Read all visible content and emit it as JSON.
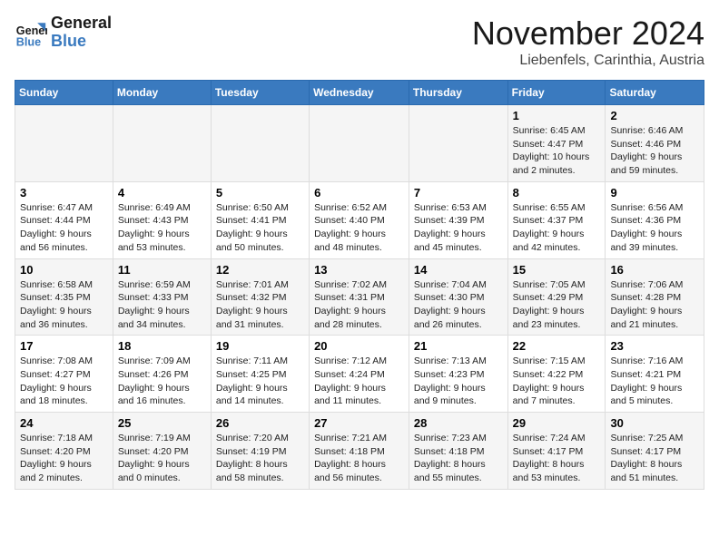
{
  "logo": {
    "line1": "General",
    "line2": "Blue"
  },
  "title": "November 2024",
  "location": "Liebenfels, Carinthia, Austria",
  "weekdays": [
    "Sunday",
    "Monday",
    "Tuesday",
    "Wednesday",
    "Thursday",
    "Friday",
    "Saturday"
  ],
  "weeks": [
    [
      {
        "day": "",
        "info": ""
      },
      {
        "day": "",
        "info": ""
      },
      {
        "day": "",
        "info": ""
      },
      {
        "day": "",
        "info": ""
      },
      {
        "day": "",
        "info": ""
      },
      {
        "day": "1",
        "info": "Sunrise: 6:45 AM\nSunset: 4:47 PM\nDaylight: 10 hours and 2 minutes."
      },
      {
        "day": "2",
        "info": "Sunrise: 6:46 AM\nSunset: 4:46 PM\nDaylight: 9 hours and 59 minutes."
      }
    ],
    [
      {
        "day": "3",
        "info": "Sunrise: 6:47 AM\nSunset: 4:44 PM\nDaylight: 9 hours and 56 minutes."
      },
      {
        "day": "4",
        "info": "Sunrise: 6:49 AM\nSunset: 4:43 PM\nDaylight: 9 hours and 53 minutes."
      },
      {
        "day": "5",
        "info": "Sunrise: 6:50 AM\nSunset: 4:41 PM\nDaylight: 9 hours and 50 minutes."
      },
      {
        "day": "6",
        "info": "Sunrise: 6:52 AM\nSunset: 4:40 PM\nDaylight: 9 hours and 48 minutes."
      },
      {
        "day": "7",
        "info": "Sunrise: 6:53 AM\nSunset: 4:39 PM\nDaylight: 9 hours and 45 minutes."
      },
      {
        "day": "8",
        "info": "Sunrise: 6:55 AM\nSunset: 4:37 PM\nDaylight: 9 hours and 42 minutes."
      },
      {
        "day": "9",
        "info": "Sunrise: 6:56 AM\nSunset: 4:36 PM\nDaylight: 9 hours and 39 minutes."
      }
    ],
    [
      {
        "day": "10",
        "info": "Sunrise: 6:58 AM\nSunset: 4:35 PM\nDaylight: 9 hours and 36 minutes."
      },
      {
        "day": "11",
        "info": "Sunrise: 6:59 AM\nSunset: 4:33 PM\nDaylight: 9 hours and 34 minutes."
      },
      {
        "day": "12",
        "info": "Sunrise: 7:01 AM\nSunset: 4:32 PM\nDaylight: 9 hours and 31 minutes."
      },
      {
        "day": "13",
        "info": "Sunrise: 7:02 AM\nSunset: 4:31 PM\nDaylight: 9 hours and 28 minutes."
      },
      {
        "day": "14",
        "info": "Sunrise: 7:04 AM\nSunset: 4:30 PM\nDaylight: 9 hours and 26 minutes."
      },
      {
        "day": "15",
        "info": "Sunrise: 7:05 AM\nSunset: 4:29 PM\nDaylight: 9 hours and 23 minutes."
      },
      {
        "day": "16",
        "info": "Sunrise: 7:06 AM\nSunset: 4:28 PM\nDaylight: 9 hours and 21 minutes."
      }
    ],
    [
      {
        "day": "17",
        "info": "Sunrise: 7:08 AM\nSunset: 4:27 PM\nDaylight: 9 hours and 18 minutes."
      },
      {
        "day": "18",
        "info": "Sunrise: 7:09 AM\nSunset: 4:26 PM\nDaylight: 9 hours and 16 minutes."
      },
      {
        "day": "19",
        "info": "Sunrise: 7:11 AM\nSunset: 4:25 PM\nDaylight: 9 hours and 14 minutes."
      },
      {
        "day": "20",
        "info": "Sunrise: 7:12 AM\nSunset: 4:24 PM\nDaylight: 9 hours and 11 minutes."
      },
      {
        "day": "21",
        "info": "Sunrise: 7:13 AM\nSunset: 4:23 PM\nDaylight: 9 hours and 9 minutes."
      },
      {
        "day": "22",
        "info": "Sunrise: 7:15 AM\nSunset: 4:22 PM\nDaylight: 9 hours and 7 minutes."
      },
      {
        "day": "23",
        "info": "Sunrise: 7:16 AM\nSunset: 4:21 PM\nDaylight: 9 hours and 5 minutes."
      }
    ],
    [
      {
        "day": "24",
        "info": "Sunrise: 7:18 AM\nSunset: 4:20 PM\nDaylight: 9 hours and 2 minutes."
      },
      {
        "day": "25",
        "info": "Sunrise: 7:19 AM\nSunset: 4:20 PM\nDaylight: 9 hours and 0 minutes."
      },
      {
        "day": "26",
        "info": "Sunrise: 7:20 AM\nSunset: 4:19 PM\nDaylight: 8 hours and 58 minutes."
      },
      {
        "day": "27",
        "info": "Sunrise: 7:21 AM\nSunset: 4:18 PM\nDaylight: 8 hours and 56 minutes."
      },
      {
        "day": "28",
        "info": "Sunrise: 7:23 AM\nSunset: 4:18 PM\nDaylight: 8 hours and 55 minutes."
      },
      {
        "day": "29",
        "info": "Sunrise: 7:24 AM\nSunset: 4:17 PM\nDaylight: 8 hours and 53 minutes."
      },
      {
        "day": "30",
        "info": "Sunrise: 7:25 AM\nSunset: 4:17 PM\nDaylight: 8 hours and 51 minutes."
      }
    ]
  ]
}
